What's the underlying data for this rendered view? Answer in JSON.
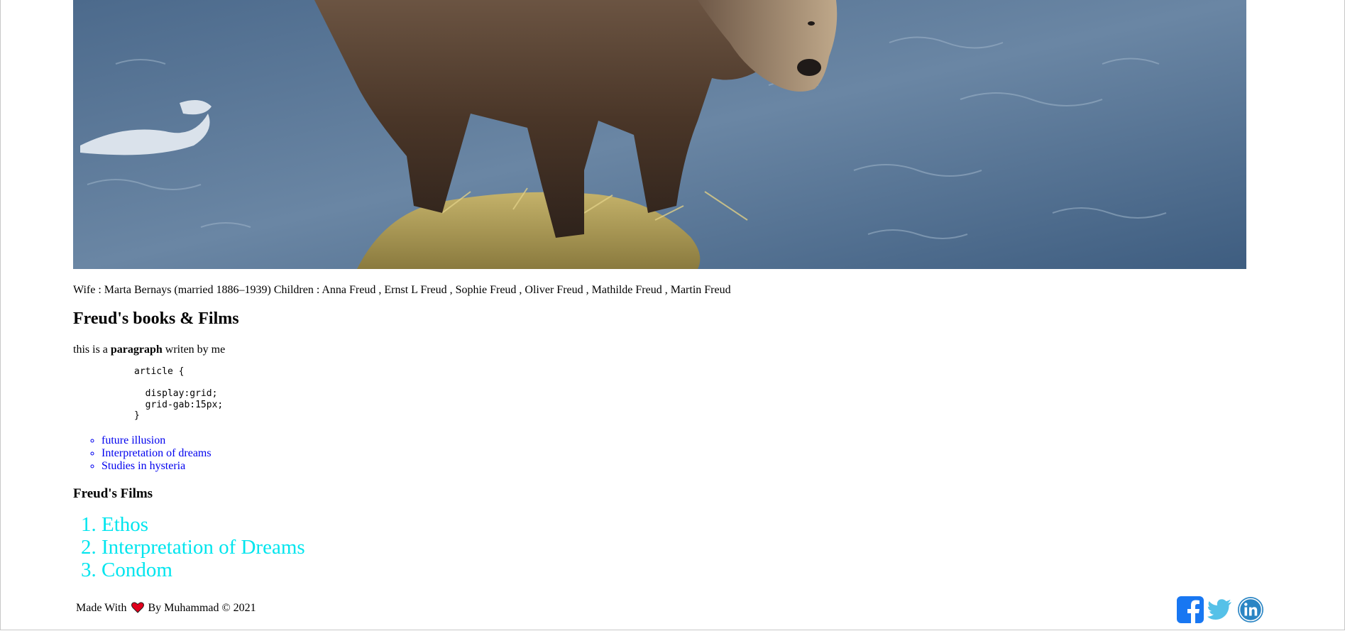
{
  "hero": {
    "image_name": "bear-in-river-photo"
  },
  "family": {
    "text": "Wife : Marta Bernays (married 1886–1939) Children : Anna Freud , Ernst L Freud , Sophie Freud , Oliver Freud , Mathilde Freud , Martin Freud"
  },
  "books": {
    "heading": "Freud's books & Films",
    "para_before": "this is a ",
    "para_bold": "paragraph",
    "para_after": " writen by me",
    "code": "article {\n\n  display:grid;\n  grid-gab:15px;\n}",
    "links": [
      "future illusion",
      "Interpretation of dreams",
      "Studies in hysteria"
    ]
  },
  "films": {
    "heading": "Freud's Films",
    "items": [
      "Ethos",
      "Interpretation of Dreams",
      "Condom"
    ]
  },
  "footer": {
    "made_with": "Made With",
    "by": "By Muhammad © 2021"
  },
  "colors": {
    "link": "#0000ee",
    "film_items": "#00e5ee",
    "facebook": "#1877f2",
    "twitter": "#55c1e8",
    "linkedin": "#2a85c4",
    "heart": "#e0001b"
  },
  "icons": {
    "heart": "heart-icon",
    "facebook": "facebook-icon",
    "twitter": "twitter-icon",
    "linkedin": "linkedin-icon"
  }
}
